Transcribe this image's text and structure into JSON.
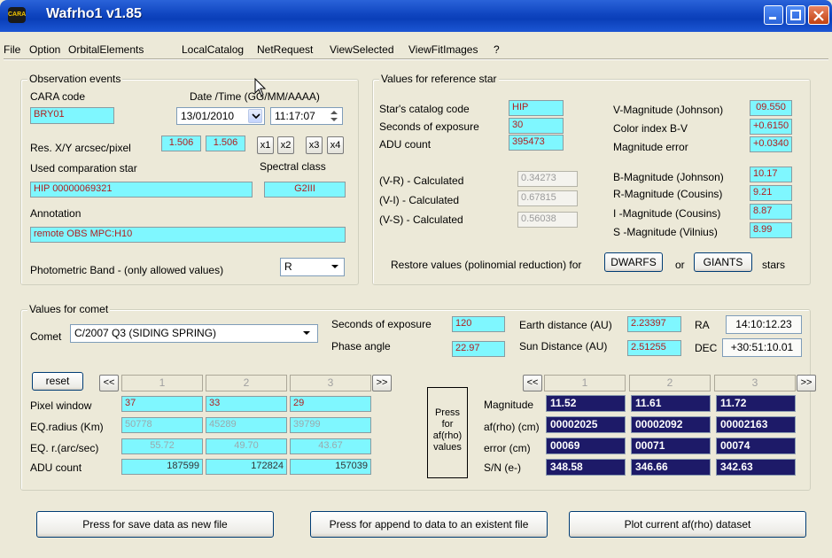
{
  "window": {
    "title": "Wafrho1 v1.85",
    "app_icon_text": "CARA"
  },
  "menu": [
    "File",
    "Option",
    "OrbitalElements",
    "LocalCatalog",
    "NetRequest",
    "ViewSelected",
    "ViewFitImages",
    "?"
  ],
  "observation": {
    "legend": "Observation events",
    "cara_code_label": "CARA code",
    "cara_code": "BRY01",
    "datetime_label": "Date /Time (GG/MM/AAAA)",
    "date": "13/01/2010",
    "time": "11:17:07",
    "res_label": "Res. X/Y arcsec/pixel",
    "res_x": "1.506",
    "res_y": "1.506",
    "zoom_buttons": [
      "x1",
      "x2",
      "x3",
      "x4"
    ],
    "comp_star_label": "Used comparation star",
    "comp_star": "HIP 00000069321",
    "spectral_label": "Spectral class",
    "spectral": "G2III",
    "annotation_label": "Annotation",
    "annotation": "remote OBS MPC:H10",
    "band_label": "Photometric Band  - (only allowed values)",
    "band": "R"
  },
  "refstar": {
    "legend": "Values for reference star",
    "catalog_label": "Star's catalog code",
    "catalog": "HIP",
    "exposure_label": "Seconds of exposure",
    "exposure": "30",
    "adu_label": "ADU count",
    "adu": "395473",
    "vr_label": "(V-R) - Calculated",
    "vr": "0.34273",
    "vi_label": "(V-I) -  Calculated",
    "vi": "0.67815",
    "vs_label": "(V-S) - Calculated",
    "vs": "0.56038",
    "vmag_label": "V-Magnitude (Johnson)",
    "vmag": "09.550",
    "bv_label": "Color index B-V",
    "bv": "+0.6150",
    "magerr_label": "Magnitude error",
    "magerr": "+0.0340",
    "bmag_label": "B-Magnitude (Johnson)",
    "bmag": "10.17",
    "rmag_label": "R-Magnitude (Cousins)",
    "rmag": "9.21",
    "imag_label": "I -Magnitude (Cousins)",
    "imag": "8.87",
    "smag_label": "S -Magnitude (Vilnius)",
    "smag": "8.99",
    "restore_label": "Restore values (polinomial reduction) for",
    "dwarfs": "DWARFS",
    "or_label": "or",
    "giants": "GIANTS",
    "stars_label": "stars"
  },
  "comet": {
    "legend": "Values for comet",
    "comet_label": "Comet",
    "comet": "C/2007 Q3 (SIDING SPRING)",
    "exposure_label": "Seconds of exposure",
    "exposure": "120",
    "phase_label": "Phase angle",
    "phase": "22.97",
    "earth_label": "Earth distance (AU)",
    "earth": "2.23397",
    "sun_label": "Sun Distance (AU)",
    "sun": "2.51255",
    "ra_label": "RA",
    "ra": "14:10:12.23",
    "dec_label": "DEC",
    "dec": "+30:51:10.01",
    "reset": "reset",
    "prev": "<<",
    "next": ">>",
    "cols": [
      "1",
      "2",
      "3"
    ],
    "row_labels": [
      "Pixel window",
      "EQ.radius (Km)",
      "EQ. r.(arc/sec)",
      "ADU count"
    ],
    "pixel_window": [
      "37",
      "33",
      "29"
    ],
    "eq_radius": [
      "50778",
      "45289",
      "39799"
    ],
    "eq_arc": [
      "55.72",
      "49.70",
      "43.67"
    ],
    "adu": [
      "187599",
      "172824",
      "157039"
    ],
    "press_afrho": "Press\nfor\naf(rho)\nvalues",
    "result_labels": [
      "Magnitude",
      "af(rho) (cm)",
      "error (cm)",
      "S/N (e-)"
    ],
    "magnitude": [
      "11.52",
      "11.61",
      "11.72"
    ],
    "afrho": [
      "00002025",
      "00002092",
      "00002163"
    ],
    "error": [
      "00069",
      "00071",
      "00074"
    ],
    "sn": [
      "348.58",
      "346.66",
      "342.63"
    ]
  },
  "footer": {
    "save": "Press for save data as new file",
    "append": "Press for append to  data to an existent file",
    "plot": "Plot current af(rho) dataset"
  }
}
